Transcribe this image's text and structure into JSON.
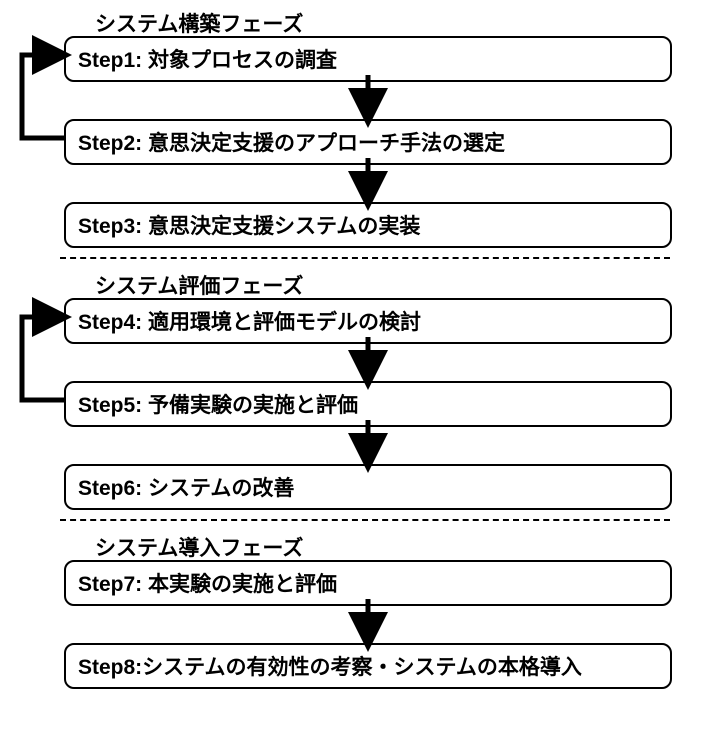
{
  "phases": {
    "p1": "システム構築フェーズ",
    "p2": "システム評価フェーズ",
    "p3": "システム導入フェーズ"
  },
  "steps": {
    "s1": "Step1: 対象プロセスの調査",
    "s2": "Step2: 意思決定支援のアプローチ手法の選定",
    "s3": "Step3: 意思決定支援システムの実装",
    "s4": "Step4: 適用環境と評価モデルの検討",
    "s5": "Step5: 予備実験の実施と評価",
    "s6": "Step6: システムの改善",
    "s7": "Step7: 本実験の実施と評価",
    "s8": "Step8:システムの有効性の考察・システムの本格導入"
  }
}
